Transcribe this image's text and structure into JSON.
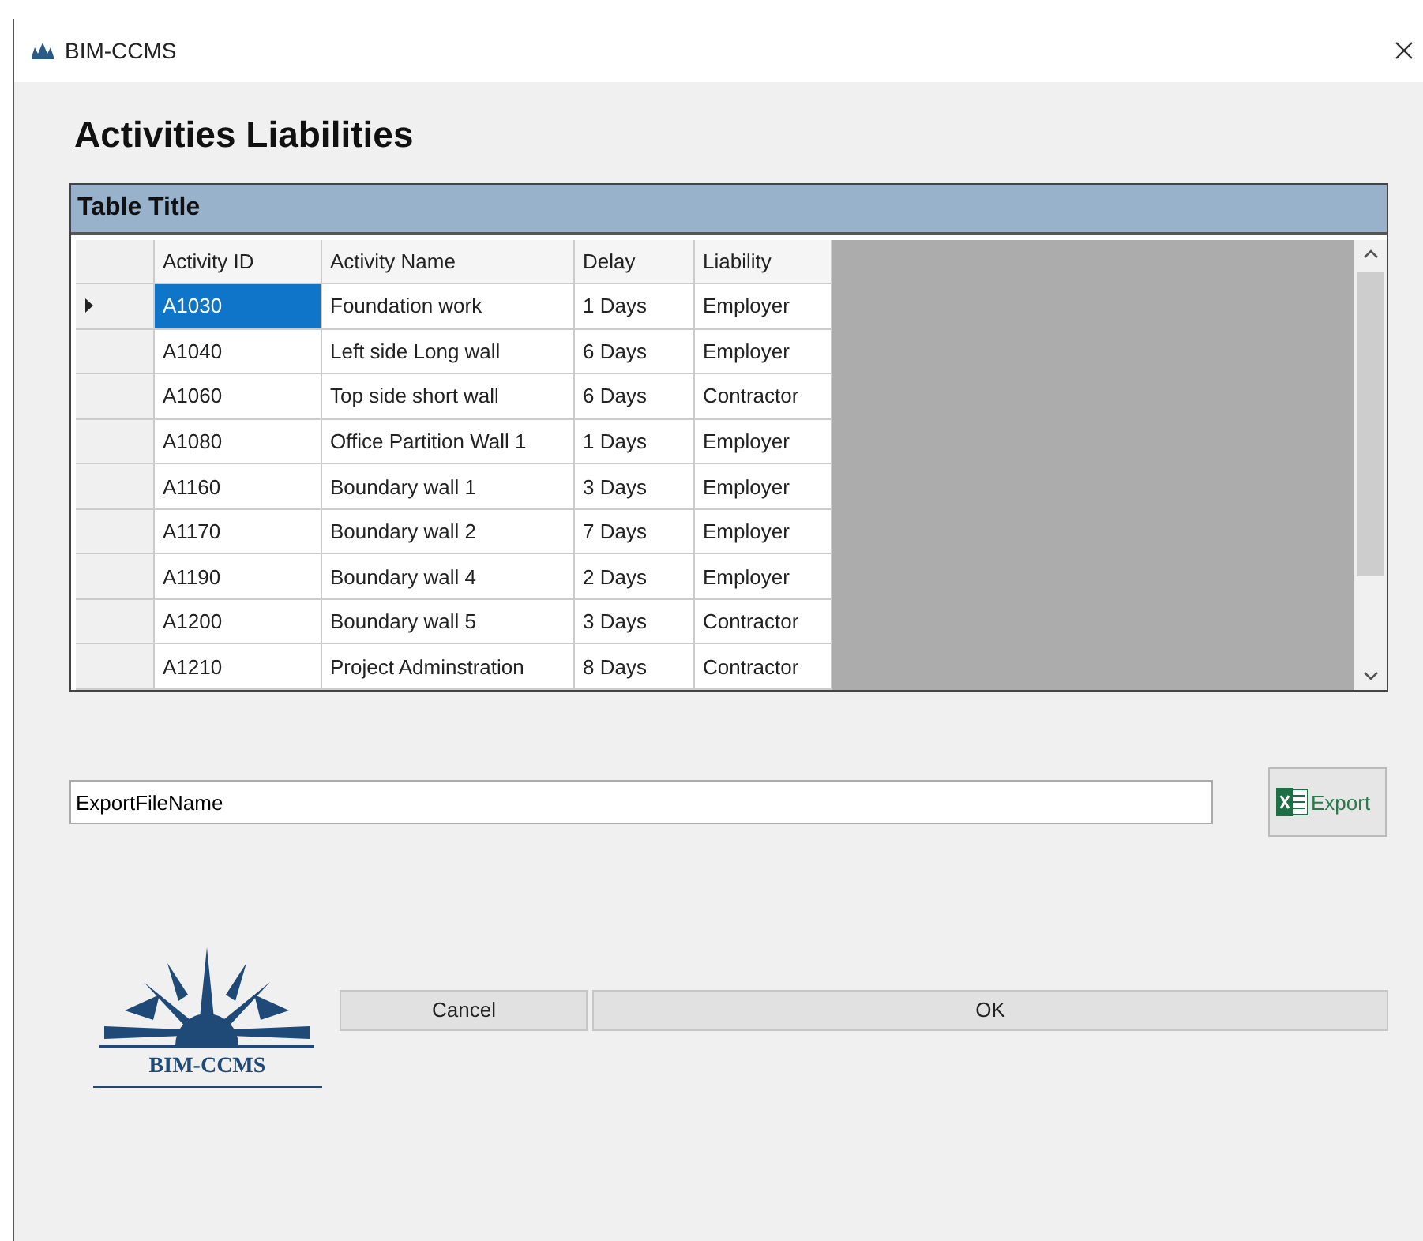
{
  "window": {
    "title": "BIM-CCMS"
  },
  "heading": "Activities Liabilities",
  "table": {
    "title": "Table Title",
    "columns": [
      "Activity ID",
      "Activity Name",
      "Delay",
      "Liability"
    ],
    "rows": [
      {
        "selected": true,
        "cells": [
          "A1030",
          "Foundation work",
          "1 Days",
          "Employer"
        ]
      },
      {
        "selected": false,
        "cells": [
          "A1040",
          "Left side Long wall",
          "6 Days",
          "Employer"
        ]
      },
      {
        "selected": false,
        "cells": [
          "A1060",
          "Top side short wall",
          "6 Days",
          "Contractor"
        ]
      },
      {
        "selected": false,
        "cells": [
          "A1080",
          "Office Partition Wall 1",
          "1 Days",
          "Employer"
        ]
      },
      {
        "selected": false,
        "cells": [
          "A1160",
          "Boundary wall 1",
          "3 Days",
          "Employer"
        ]
      },
      {
        "selected": false,
        "cells": [
          "A1170",
          "Boundary wall 2",
          "7 Days",
          "Employer"
        ]
      },
      {
        "selected": false,
        "cells": [
          "A1190",
          "Boundary wall 4",
          "2 Days",
          "Employer"
        ]
      },
      {
        "selected": false,
        "cells": [
          "A1200",
          "Boundary wall 5",
          "3 Days",
          "Contractor"
        ]
      },
      {
        "selected": false,
        "cells": [
          "A1210",
          "Project Adminstration",
          "8 Days",
          "Contractor"
        ]
      }
    ]
  },
  "export": {
    "value": "ExportFileName",
    "button": "Export"
  },
  "logo": {
    "text": "BIM-CCMS"
  },
  "buttons": {
    "cancel": "Cancel",
    "ok": "OK"
  }
}
